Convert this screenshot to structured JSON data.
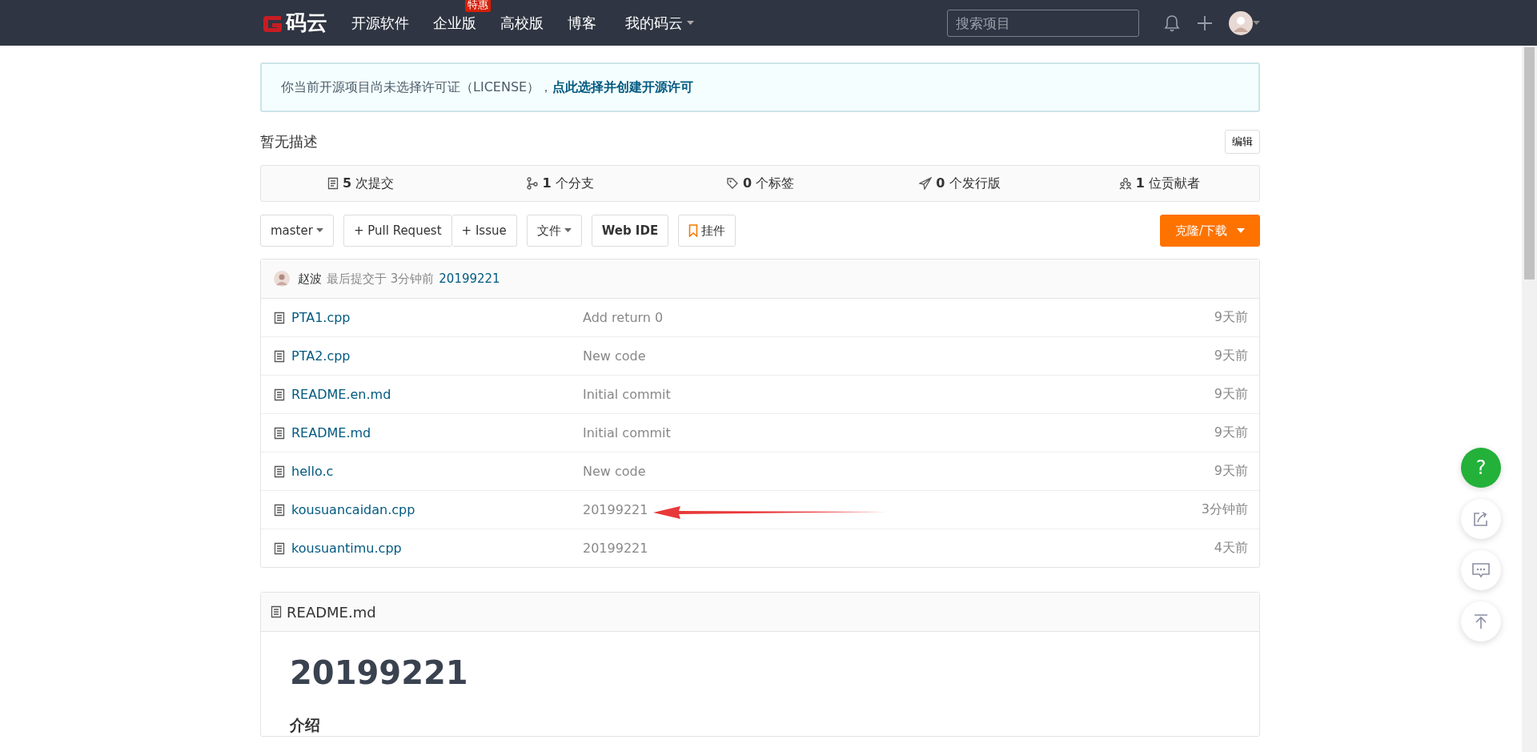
{
  "topbar": {
    "logo": "码云",
    "nav": [
      {
        "label": "开源软件"
      },
      {
        "label": "企业版",
        "badge": "特惠"
      },
      {
        "label": "高校版"
      },
      {
        "label": "博客"
      },
      {
        "label": "我的码云",
        "dropdown": true
      }
    ],
    "search": {
      "placeholder": "搜索项目"
    }
  },
  "notice": {
    "text": "你当前开源项目尚未选择许可证（LICENSE），",
    "link": "点此选择并创建开源许可"
  },
  "description": "暂无描述",
  "edit_button": "编辑",
  "stats": [
    {
      "kind": "commits",
      "count": "5",
      "label": "次提交"
    },
    {
      "kind": "branches",
      "count": "1",
      "label": "个分支"
    },
    {
      "kind": "tags",
      "count": "0",
      "label": "个标签"
    },
    {
      "kind": "releases",
      "count": "0",
      "label": "个发行版"
    },
    {
      "kind": "contributors",
      "count": "1",
      "label": "位贡献者"
    }
  ],
  "toolbar": {
    "branch": "master",
    "pull_request": "+ Pull Request",
    "issue": "+ Issue",
    "files": "文件",
    "web_ide": "Web IDE",
    "widget": "挂件",
    "clone": "克隆/下载"
  },
  "last_commit": {
    "author": "赵波",
    "text": "最后提交于",
    "time": "3分钟前",
    "message": "20199221"
  },
  "files": [
    {
      "name": "PTA1.cpp",
      "message": "Add return 0",
      "time": "9天前"
    },
    {
      "name": "PTA2.cpp",
      "message": "New code",
      "time": "9天前"
    },
    {
      "name": "README.en.md",
      "message": "Initial commit",
      "time": "9天前"
    },
    {
      "name": "README.md",
      "message": "Initial commit",
      "time": "9天前"
    },
    {
      "name": "hello.c",
      "message": "New code",
      "time": "9天前"
    },
    {
      "name": "kousuancaidan.cpp",
      "message": "20199221",
      "time": "3分钟前"
    },
    {
      "name": "kousuantimu.cpp",
      "message": "20199221",
      "time": "4天前"
    }
  ],
  "readme": {
    "file": "README.md",
    "title": "20199221",
    "section": "介绍"
  },
  "float_buttons": [
    {
      "kind": "help",
      "label": "?"
    },
    {
      "kind": "share"
    },
    {
      "kind": "comment"
    },
    {
      "kind": "top"
    }
  ]
}
